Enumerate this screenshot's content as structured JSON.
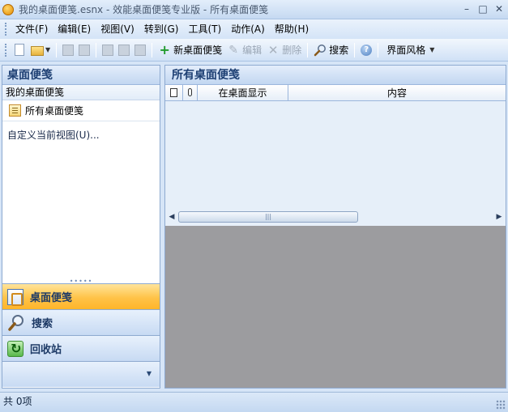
{
  "window": {
    "title": "我的桌面便笺.esnx - 效能桌面便笺专业版 - 所有桌面便笺",
    "minimize": "–",
    "maximize": "□",
    "close": "✕"
  },
  "menu": [
    "文件(F)",
    "编辑(E)",
    "视图(V)",
    "转到(G)",
    "工具(T)",
    "动作(A)",
    "帮助(H)"
  ],
  "toolbar": {
    "new_note": "新桌面便笺",
    "edit": "编辑",
    "delete": "删除",
    "search": "搜索",
    "style": "界面风格"
  },
  "left_pane": {
    "title": "桌面便笺",
    "root": "我的桌面便笺",
    "node": "所有桌面便笺",
    "custom_view": "自定义当前视图(U)...",
    "nav": [
      "桌面便笺",
      "搜索",
      "回收站"
    ]
  },
  "right_pane": {
    "title": "所有桌面便笺",
    "columns": {
      "desk": "在桌面显示",
      "content": "内容"
    }
  },
  "status": {
    "count": "共 0项"
  }
}
